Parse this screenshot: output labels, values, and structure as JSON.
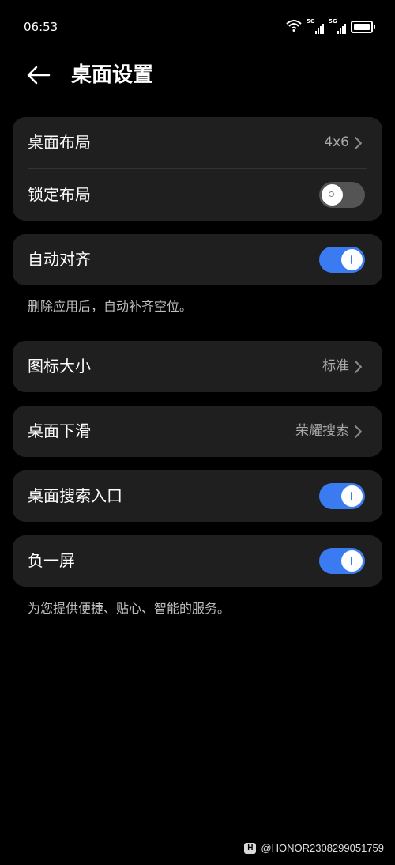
{
  "status_bar": {
    "time": "06:53",
    "sim1_tag": "5G",
    "sim2_tag": "5G",
    "icons": [
      "wifi-icon",
      "signal-icon",
      "signal-icon",
      "battery-icon"
    ]
  },
  "header": {
    "title": "桌面设置",
    "back_icon": "arrow-left-icon"
  },
  "settings": {
    "layout": {
      "label": "桌面布局",
      "value": "4x6"
    },
    "lock_layout": {
      "label": "锁定布局",
      "enabled": false
    },
    "auto_align": {
      "label": "自动对齐",
      "enabled": true,
      "note": "删除应用后，自动补齐空位。"
    },
    "icon_size": {
      "label": "图标大小",
      "value": "标准"
    },
    "swipe_down": {
      "label": "桌面下滑",
      "value": "荣耀搜索"
    },
    "search_entry": {
      "label": "桌面搜索入口",
      "enabled": true
    },
    "minus_one_screen": {
      "label": "负一屏",
      "enabled": true,
      "note": "为您提供便捷、贴心、智能的服务。"
    }
  },
  "colors": {
    "accent": "#3b7bf2",
    "card": "#1f1f1f",
    "background": "#000000"
  },
  "watermark": {
    "text": "@HONOR2308299051759",
    "icon_glyph": "H"
  }
}
